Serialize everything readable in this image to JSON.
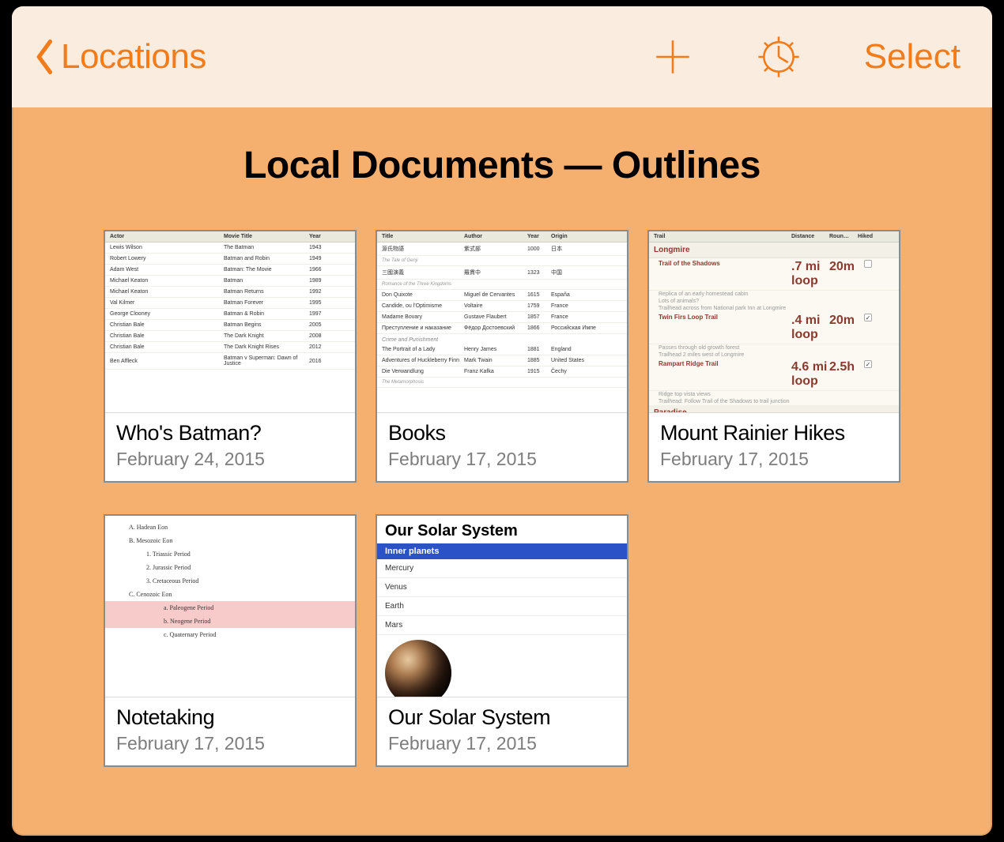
{
  "colors": {
    "accent": "#f27b1a",
    "toolbar_bg": "#fbece0",
    "page_bg": "#f5af6f"
  },
  "toolbar": {
    "back_label": "Locations",
    "select_label": "Select"
  },
  "page_title": "Local Documents — Outlines",
  "docs": [
    {
      "title": "Who's Batman?",
      "date": "February 24, 2015"
    },
    {
      "title": "Books",
      "date": "February 17, 2015"
    },
    {
      "title": "Mount Rainier Hikes",
      "date": "February 17, 2015"
    },
    {
      "title": "Notetaking",
      "date": "February 17, 2015"
    },
    {
      "title": "Our Solar System",
      "date": "February 17, 2015"
    }
  ],
  "previews": {
    "batman": {
      "headers": [
        "Actor",
        "Movie Title",
        "Year"
      ],
      "rows": [
        [
          "Lewis Wilson",
          "The Batman",
          "1943"
        ],
        [
          "Robert Lowery",
          "Batman and Robin",
          "1949"
        ],
        [
          "Adam West",
          "Batman: The Movie",
          "1966"
        ],
        [
          "Michael Keaton",
          "Batman",
          "1989"
        ],
        [
          "Michael Keaton",
          "Batman Returns",
          "1992"
        ],
        [
          "Val Kilmer",
          "Batman Forever",
          "1995"
        ],
        [
          "George Clooney",
          "Batman & Robin",
          "1997"
        ],
        [
          "Christian Bale",
          "Batman Begins",
          "2005"
        ],
        [
          "Christian Bale",
          "The Dark Knight",
          "2008"
        ],
        [
          "Christian Bale",
          "The Dark Knight Rises",
          "2012"
        ],
        [
          "Ben Affleck",
          "Batman v Superman: Dawn of Justice",
          "2016"
        ]
      ]
    },
    "books": {
      "headers": [
        "Title",
        "Author",
        "Year",
        "Origin"
      ],
      "sections": [
        {
          "rows": [
            [
              "源氏物語",
              "紫式部",
              "1000",
              "日本"
            ],
            [
              "The Tale of Genji",
              "",
              "",
              ""
            ]
          ]
        },
        {
          "rows": [
            [
              "三國演義",
              "羅貫中",
              "1323",
              "中国"
            ],
            [
              "Romance of the Three Kingdoms",
              "",
              "",
              ""
            ]
          ]
        },
        {
          "rows": [
            [
              "Don Quixote",
              "Miguel de Cervantes",
              "1615",
              "España"
            ],
            [
              "Candide, ou l'Optimisme",
              "Voltaire",
              "1759",
              "France"
            ],
            [
              "Madame Bovary",
              "Gustave Flaubert",
              "1857",
              "France"
            ],
            [
              "Преступление и наказание",
              "Фёдор Достоевский",
              "1866",
              "Российская Импе"
            ]
          ]
        },
        {
          "heading": "Crime and Punishment",
          "rows": [
            [
              "The Portrait of a Lady",
              "Henry James",
              "1881",
              "England"
            ],
            [
              "Adventures of Huckleberry Finn",
              "Mark Twain",
              "1885",
              "United States"
            ],
            [
              "Die Verwandlung",
              "Franz Kafka",
              "1915",
              "Čechy"
            ],
            [
              "The Metamorphosis",
              "",
              "",
              ""
            ]
          ]
        }
      ]
    },
    "hikes": {
      "headers": [
        "Trail",
        "Distance",
        "Roun…",
        "Hiked"
      ],
      "groups": [
        {
          "name": "Longmire",
          "trails": [
            {
              "name": "Trail of the Shadows",
              "distance": ".7 mi loop",
              "time": "20m",
              "hiked": false,
              "notes": [
                "Replica of an early homestead cabin",
                "Lots of animals?",
                "Trailhead across from National park Inn at Longmire"
              ]
            },
            {
              "name": "Twin Firs Loop Trail",
              "distance": ".4 mi loop",
              "time": "20m",
              "hiked": true,
              "notes": [
                "Passes through old growth forest",
                "Trailhead 2 miles west of Longmire"
              ]
            },
            {
              "name": "Rampart Ridge Trail",
              "distance": "4.6 mi loop",
              "time": "2.5h",
              "hiked": true,
              "notes": [
                "Ridge top vista views",
                "Trailhead: Follow Trail of the Shadows to trail junction"
              ]
            }
          ]
        },
        {
          "name": "Paradise",
          "trails": []
        }
      ]
    },
    "notetaking": {
      "items": [
        {
          "lv": 1,
          "label": "Hadean Eon",
          "sel": false,
          "marker": "A."
        },
        {
          "lv": 1,
          "label": "Mesozoic Eon",
          "sel": false,
          "marker": "B."
        },
        {
          "lv": 2,
          "label": "Triassic Period",
          "sel": false,
          "marker": "1."
        },
        {
          "lv": 2,
          "label": "Jurassic Period",
          "sel": false,
          "marker": "2."
        },
        {
          "lv": 2,
          "label": "Cretaceous Period",
          "sel": false,
          "marker": "3."
        },
        {
          "lv": 1,
          "label": "Cenozoic Eon",
          "sel": false,
          "marker": "C."
        },
        {
          "lv": 3,
          "label": "Paleogene Period",
          "sel": true,
          "marker": "a."
        },
        {
          "lv": 3,
          "label": "Neogene Period",
          "sel": true,
          "marker": "b."
        },
        {
          "lv": 3,
          "label": "Quaternary Period",
          "sel": false,
          "marker": "c."
        }
      ]
    },
    "solar": {
      "title": "Our Solar System",
      "section": "Inner planets",
      "rows": [
        "Mercury",
        "Venus",
        "Earth",
        "Mars"
      ],
      "image_label": "mars"
    }
  }
}
